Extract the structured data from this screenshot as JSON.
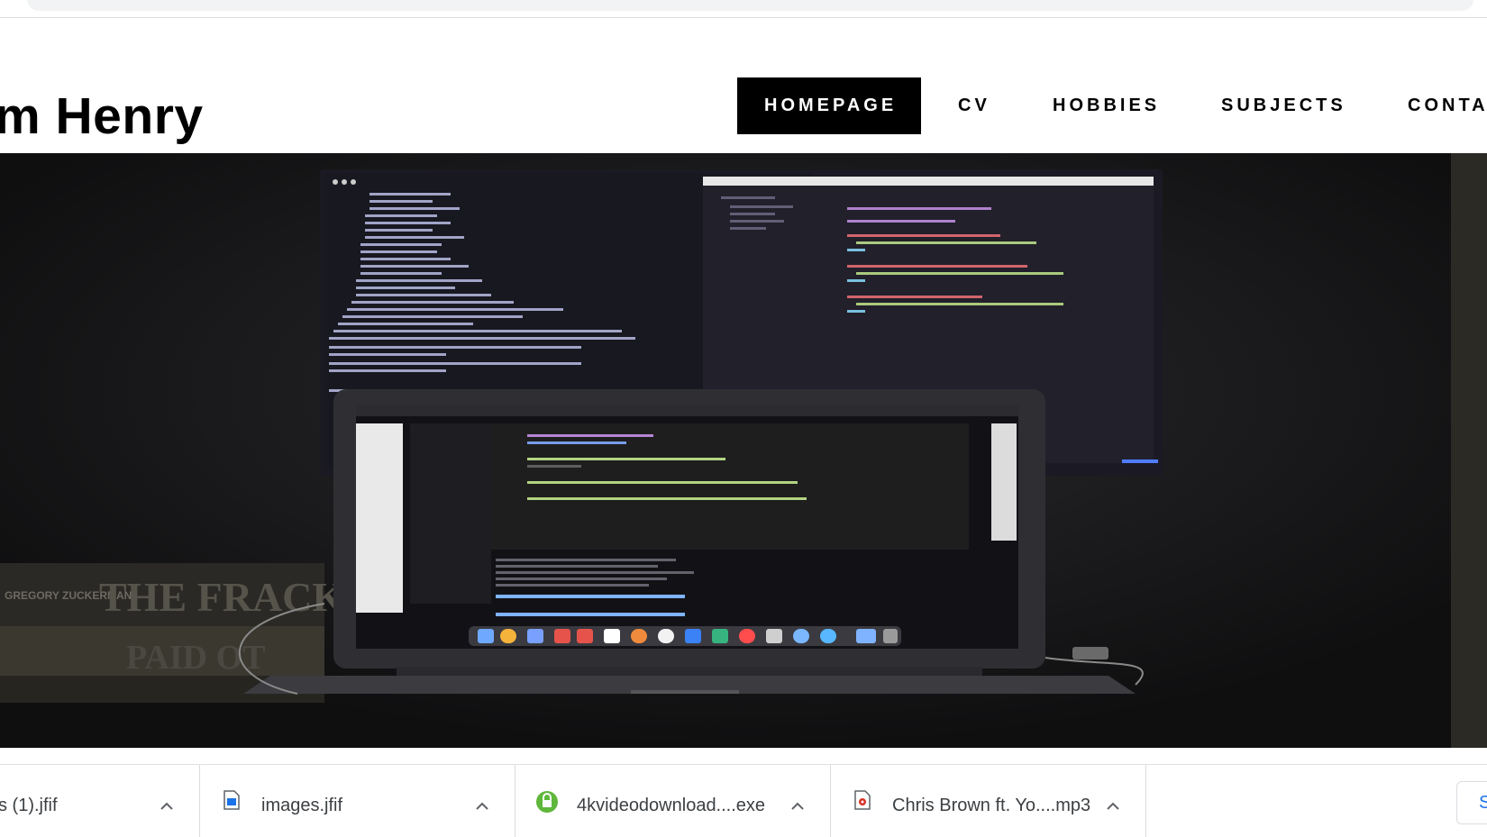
{
  "header": {
    "title": "m Henry"
  },
  "nav": {
    "items": [
      {
        "label": "HOMEPAGE",
        "active": true
      },
      {
        "label": "CV",
        "active": false
      },
      {
        "label": "HOBBIES",
        "active": false
      },
      {
        "label": "SUBJECTS",
        "active": false
      },
      {
        "label": "CONTA",
        "active": false
      }
    ]
  },
  "hero": {
    "books": [
      "GREGORY ZUCKERMAN",
      "THE FRACKE",
      "PAID OT"
    ]
  },
  "downloads": {
    "items": [
      {
        "name": "s (1).jfif",
        "icon": "image-file-icon"
      },
      {
        "name": "images.jfif",
        "icon": "image-file-icon"
      },
      {
        "name": "4kvideodownload....exe",
        "icon": "installer-icon"
      },
      {
        "name": "Chris Brown ft. Yo....mp3",
        "icon": "audio-file-icon"
      }
    ],
    "show_all_label": "S"
  },
  "colors": {
    "nav_active_bg": "#000000",
    "nav_active_fg": "#ffffff",
    "hero_bg": "#141414",
    "link_blue": "#1a73e8"
  }
}
